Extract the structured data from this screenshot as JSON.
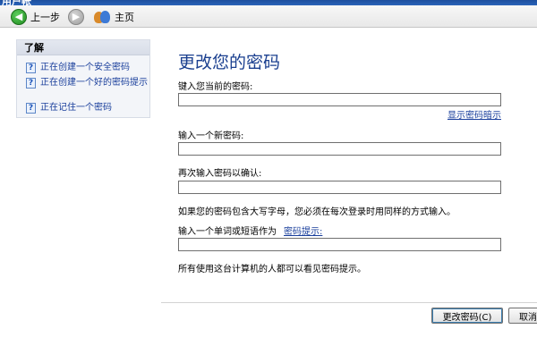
{
  "window": {
    "title": "用户帐"
  },
  "toolbar": {
    "back_label": "上一步",
    "home_label": "主页"
  },
  "sidebar": {
    "title": "了解",
    "links": [
      {
        "label": "正在创建一个安全密码"
      },
      {
        "label": "正在创建一个好的密码提示"
      },
      {
        "label": "正在记住一个密码"
      }
    ]
  },
  "main": {
    "title": "更改您的密码",
    "current_password_label": "键入您当前的密码:",
    "current_password_value": "",
    "show_hint_link": "显示密码暗示",
    "new_password_label": "输入一个新密码:",
    "new_password_value": "",
    "confirm_password_label": "再次输入密码以确认:",
    "confirm_password_value": "",
    "case_note": "如果您的密码包含大写字母，您必须在每次登录时用同样的方式输入。",
    "hint_label": "输入一个单词或短语作为",
    "hint_link": "密码提示:",
    "hint_value": "",
    "visibility_note": "所有使用这台计算机的人都可以看见密码提示。"
  },
  "buttons": {
    "change_password": "更改密码(C)",
    "cancel": "取消"
  }
}
